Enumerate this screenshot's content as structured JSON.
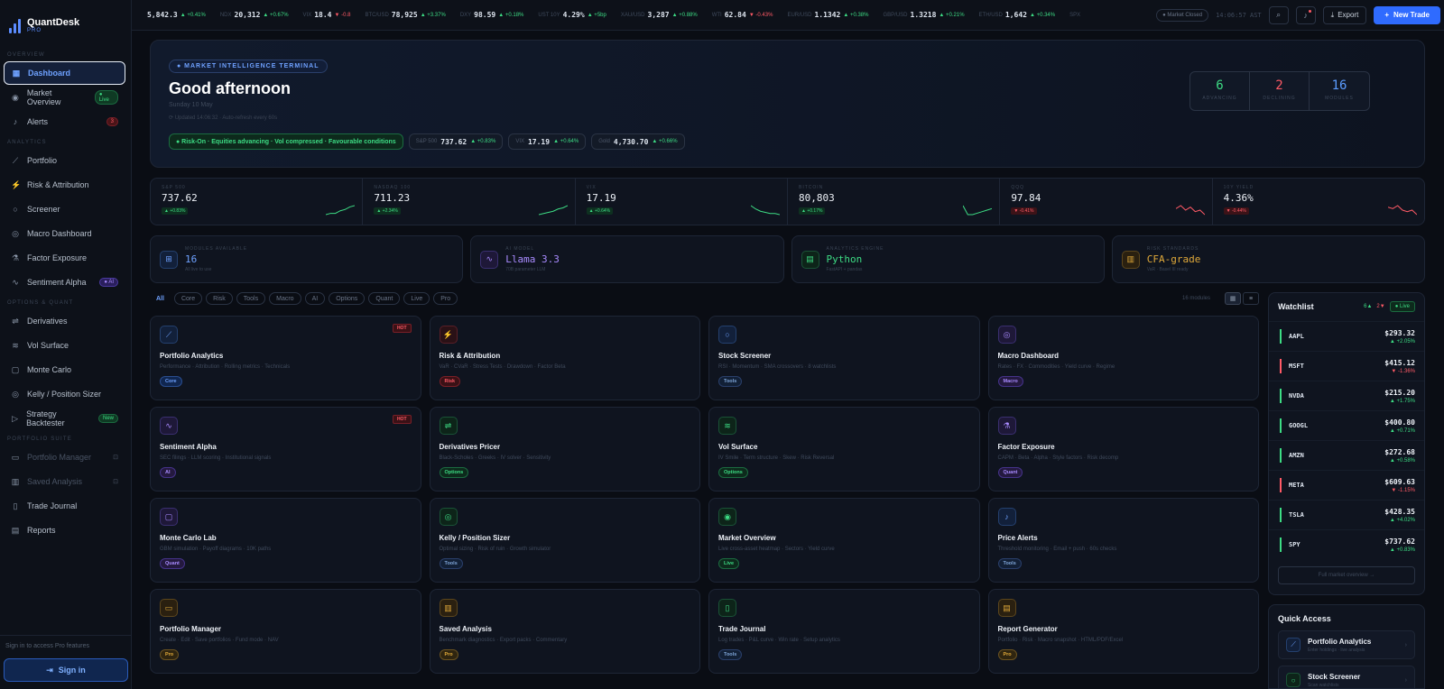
{
  "app": {
    "name": "QuantDesk",
    "sub": "PRO"
  },
  "sidebar": {
    "sections": [
      {
        "label": "OVERVIEW",
        "items": [
          {
            "label": "Dashboard",
            "icon": "grid-icon",
            "glyph": "▦",
            "active": true
          },
          {
            "label": "Market Overview",
            "icon": "broadcast-icon",
            "glyph": "◉",
            "badge": "● Live",
            "badge_kind": "live"
          },
          {
            "label": "Alerts",
            "icon": "bell-icon",
            "glyph": "♪",
            "badge": "3",
            "badge_kind": "red"
          }
        ]
      },
      {
        "label": "ANALYTICS",
        "items": [
          {
            "label": "Portfolio",
            "icon": "trend-icon",
            "glyph": "⟋"
          },
          {
            "label": "Risk & Attribution",
            "icon": "bolt-icon",
            "glyph": "⚡"
          },
          {
            "label": "Screener",
            "icon": "search-icon",
            "glyph": "○"
          },
          {
            "label": "Macro Dashboard",
            "icon": "globe-icon",
            "glyph": "◎"
          },
          {
            "label": "Factor Exposure",
            "icon": "flask-icon",
            "glyph": "⚗"
          },
          {
            "label": "Sentiment Alpha",
            "icon": "pulse-icon",
            "glyph": "∿",
            "badge": "● AI",
            "badge_kind": "ai"
          }
        ]
      },
      {
        "label": "OPTIONS & QUANT",
        "items": [
          {
            "label": "Derivatives",
            "icon": "sliders-icon",
            "glyph": "⇌"
          },
          {
            "label": "Vol Surface",
            "icon": "layers-icon",
            "glyph": "≋"
          },
          {
            "label": "Monte Carlo",
            "icon": "dice-icon",
            "glyph": "▢"
          },
          {
            "label": "Kelly / Position Sizer",
            "icon": "target-icon",
            "glyph": "◎"
          },
          {
            "label": "Strategy Backtester",
            "icon": "play-icon",
            "glyph": "▷",
            "badge": "New",
            "badge_kind": "new"
          }
        ]
      },
      {
        "label": "PORTFOLIO SUITE",
        "items": [
          {
            "label": "Portfolio Manager",
            "icon": "folder-icon",
            "glyph": "▭",
            "locked": true
          },
          {
            "label": "Saved Analysis",
            "icon": "chart-icon",
            "glyph": "▥",
            "locked": true
          },
          {
            "label": "Trade Journal",
            "icon": "book-icon",
            "glyph": "▯"
          },
          {
            "label": "Reports",
            "icon": "document-icon",
            "glyph": "▤"
          }
        ]
      }
    ],
    "footer_note": "Sign in to access Pro features",
    "signin_label": "Sign in"
  },
  "ticker": [
    {
      "sym": "",
      "val": "5,842.3",
      "chg": "▲ +0.41%",
      "dir": "up"
    },
    {
      "sym": "NDX",
      "val": "20,312",
      "chg": "▲ +0.67%",
      "dir": "up"
    },
    {
      "sym": "VIX",
      "val": "18.4",
      "chg": "▼ -0.8",
      "dir": "dn"
    },
    {
      "sym": "BTC/USD",
      "val": "78,925",
      "chg": "▲ +3.37%",
      "dir": "up"
    },
    {
      "sym": "DXY",
      "val": "98.59",
      "chg": "▲ +0.18%",
      "dir": "up"
    },
    {
      "sym": "UST 10Y",
      "val": "4.29%",
      "chg": "▲ +5bp",
      "dir": "up"
    },
    {
      "sym": "XAU/USD",
      "val": "3,287",
      "chg": "▲ +0.88%",
      "dir": "up"
    },
    {
      "sym": "WTI",
      "val": "62.84",
      "chg": "▼ -0.43%",
      "dir": "dn"
    },
    {
      "sym": "EUR/USD",
      "val": "1.1342",
      "chg": "▲ +0.38%",
      "dir": "up"
    },
    {
      "sym": "GBP/USD",
      "val": "1.3218",
      "chg": "▲ +0.21%",
      "dir": "up"
    },
    {
      "sym": "ETH/USD",
      "val": "1,642",
      "chg": "▲ +0.34%",
      "dir": "up"
    },
    {
      "sym": "SPX",
      "val": "",
      "chg": "",
      "dir": "up"
    }
  ],
  "topbar": {
    "market_status": "● Market Closed",
    "clock": "14:06:57 AST",
    "export_label": "Export",
    "new_trade_label": "New Trade"
  },
  "hero": {
    "pill": "● MARKET INTELLIGENCE TERMINAL",
    "greeting": "Good afternoon",
    "date": "Sunday 10 May",
    "updated": "⟳ Updated 14:06:32 · Auto-refresh every 60s",
    "risk_chip": "● Risk-On · Equities advancing · Vol compressed · Favourable conditions",
    "chips": [
      {
        "label": "S&P 500",
        "val": "737.62",
        "chg": "▲ +0.83%"
      },
      {
        "label": "VIX",
        "val": "17.19",
        "chg": "▲ +0.64%"
      },
      {
        "label": "Gold",
        "val": "4,730.70",
        "chg": "▲ +0.66%"
      }
    ],
    "counts": [
      {
        "n": "6",
        "label": "ADVANCING",
        "color": "#3ddc84"
      },
      {
        "n": "2",
        "label": "DECLINING",
        "color": "#ff5a66"
      },
      {
        "n": "16",
        "label": "MODULES",
        "color": "#5b9cff"
      }
    ]
  },
  "indices": [
    {
      "label": "S&P 500",
      "val": "737.62",
      "chg": "▲ +0.83%",
      "dir": "up",
      "spark": [
        2,
        3,
        3,
        5,
        6,
        8,
        9
      ]
    },
    {
      "label": "NASDAQ 100",
      "val": "711.23",
      "chg": "▲ +2.34%",
      "dir": "up",
      "spark": [
        1,
        2,
        3,
        4,
        6,
        7,
        9
      ]
    },
    {
      "label": "VIX",
      "val": "17.19",
      "chg": "▲ +0.64%",
      "dir": "up",
      "spark": [
        9,
        6,
        4,
        3,
        2,
        2,
        1
      ]
    },
    {
      "label": "BITCOIN",
      "val": "80,803",
      "chg": "▲ +0.17%",
      "dir": "up",
      "spark": [
        8,
        2,
        2,
        3,
        4,
        5,
        6
      ]
    },
    {
      "label": "QQQ",
      "val": "97.84",
      "chg": "▼ -0.41%",
      "dir": "dn",
      "spark": [
        6,
        8,
        5,
        7,
        4,
        5,
        2
      ]
    },
    {
      "label": "10Y YIELD",
      "val": "4.36%",
      "chg": "▼ -0.44%",
      "dir": "dn",
      "spark": [
        7,
        6,
        8,
        5,
        4,
        5,
        2
      ]
    }
  ],
  "stats": [
    {
      "label": "MODULES AVAILABLE",
      "val": "16",
      "sub": "All live to use",
      "icon": "cpu-icon",
      "glyph": "⊞",
      "kind": "blue",
      "color": "#6ea1ff"
    },
    {
      "label": "AI MODEL",
      "val": "Llama 3.3",
      "sub": "70B parameter LLM",
      "icon": "pulse-icon",
      "glyph": "∿",
      "kind": "purple",
      "color": "#a98bff"
    },
    {
      "label": "ANALYTICS ENGINE",
      "val": "Python",
      "sub": "FastAPI + pandas",
      "icon": "database-icon",
      "glyph": "▤",
      "kind": "green",
      "color": "#3ddc84"
    },
    {
      "label": "RISK STANDARDS",
      "val": "CFA-grade",
      "sub": "VaR · Basel III ready",
      "icon": "bar-chart-icon",
      "glyph": "▥",
      "kind": "amber",
      "color": "#e0a93a"
    }
  ],
  "filters": [
    "All",
    "Core",
    "Risk",
    "Tools",
    "Macro",
    "AI",
    "Options",
    "Quant",
    "Live",
    "Pro"
  ],
  "module_count": "16 modules",
  "modules": [
    {
      "title": "Portfolio Analytics",
      "desc": "Performance · Attribution · Rolling metrics · Technicals",
      "tag": "Core",
      "tagc": "core",
      "icon": "trend-icon",
      "glyph": "⟋",
      "kind": "blue",
      "hot": true
    },
    {
      "title": "Risk & Attribution",
      "desc": "VaR · CVaR · Stress Tests · Drawdown · Factor Beta",
      "tag": "Risk",
      "tagc": "risk",
      "icon": "bolt-icon",
      "glyph": "⚡",
      "kind": "red"
    },
    {
      "title": "Stock Screener",
      "desc": "RSI · Momentum · SMA crossovers · 8 watchlists",
      "tag": "Tools",
      "tagc": "tools",
      "icon": "search-icon",
      "glyph": "○",
      "kind": "blue"
    },
    {
      "title": "Macro Dashboard",
      "desc": "Rates · FX · Commodities · Yield curve · Regime",
      "tag": "Macro",
      "tagc": "macro",
      "icon": "globe-icon",
      "glyph": "◎",
      "kind": "purple"
    },
    {
      "title": "Sentiment Alpha",
      "desc": "SEC filings · LLM scoring · Institutional signals",
      "tag": "AI",
      "tagc": "ai",
      "icon": "pulse-icon",
      "glyph": "∿",
      "kind": "purple",
      "hot": true
    },
    {
      "title": "Derivatives Pricer",
      "desc": "Black-Scholes · Greeks · IV solver · Sensitivity",
      "tag": "Options",
      "tagc": "options",
      "icon": "sliders-icon",
      "glyph": "⇌",
      "kind": "green"
    },
    {
      "title": "Vol Surface",
      "desc": "IV Smile · Term structure · Skew · Risk Reversal",
      "tag": "Options",
      "tagc": "options",
      "icon": "layers-icon",
      "glyph": "≋",
      "kind": "green"
    },
    {
      "title": "Factor Exposure",
      "desc": "CAPM · Beta · Alpha · Style factors · Risk decomp",
      "tag": "Quant",
      "tagc": "quant",
      "icon": "flask-icon",
      "glyph": "⚗",
      "kind": "purple"
    },
    {
      "title": "Monte Carlo Lab",
      "desc": "GBM simulation · Payoff diagrams · 10K paths",
      "tag": "Quant",
      "tagc": "quant",
      "icon": "dice-icon",
      "glyph": "▢",
      "kind": "purple"
    },
    {
      "title": "Kelly / Position Sizer",
      "desc": "Optimal sizing · Risk of ruin · Growth simulator",
      "tag": "Tools",
      "tagc": "tools",
      "icon": "target-icon",
      "glyph": "◎",
      "kind": "green"
    },
    {
      "title": "Market Overview",
      "desc": "Live cross-asset heatmap · Sectors · Yield curve",
      "tag": "Live",
      "tagc": "live",
      "icon": "broadcast-icon",
      "glyph": "◉",
      "kind": "green"
    },
    {
      "title": "Price Alerts",
      "desc": "Threshold monitoring · Email + push · 60s checks",
      "tag": "Tools",
      "tagc": "tools",
      "icon": "bell-icon",
      "glyph": "♪",
      "kind": "blue"
    },
    {
      "title": "Portfolio Manager",
      "desc": "Create · Edit · Save portfolios · Fund mode · NAV",
      "tag": "Pro",
      "tagc": "pro",
      "icon": "folder-icon",
      "glyph": "▭",
      "kind": "amber"
    },
    {
      "title": "Saved Analysis",
      "desc": "Benchmark diagnostics · Export packs · Commentary",
      "tag": "Pro",
      "tagc": "pro",
      "icon": "bar-chart-icon",
      "glyph": "▥",
      "kind": "amber"
    },
    {
      "title": "Trade Journal",
      "desc": "Log trades · P&L curve · Win rate · Setup analytics",
      "tag": "Tools",
      "tagc": "tools",
      "icon": "book-icon",
      "glyph": "▯",
      "kind": "green"
    },
    {
      "title": "Report Generator",
      "desc": "Portfolio · Risk · Macro snapshot · HTML/PDF/Excel",
      "tag": "Pro",
      "tagc": "pro",
      "icon": "document-icon",
      "glyph": "▤",
      "kind": "amber"
    }
  ],
  "hot_label": "HOT",
  "watchlist": {
    "title": "Watchlist",
    "up_count": "6▲",
    "down_count": "2▼",
    "live_label": "● Live",
    "rows": [
      {
        "sym": "AAPL",
        "price": "$293.32",
        "chg": "▲ +2.05%",
        "dir": "up"
      },
      {
        "sym": "MSFT",
        "price": "$415.12",
        "chg": "▼ -1.36%",
        "dir": "dn"
      },
      {
        "sym": "NVDA",
        "price": "$215.20",
        "chg": "▲ +1.75%",
        "dir": "up"
      },
      {
        "sym": "GOOGL",
        "price": "$400.80",
        "chg": "▲ +0.71%",
        "dir": "up"
      },
      {
        "sym": "AMZN",
        "price": "$272.68",
        "chg": "▲ +0.58%",
        "dir": "up"
      },
      {
        "sym": "META",
        "price": "$609.63",
        "chg": "▼ -1.15%",
        "dir": "dn"
      },
      {
        "sym": "TSLA",
        "price": "$428.35",
        "chg": "▲ +4.02%",
        "dir": "up"
      },
      {
        "sym": "SPY",
        "price": "$737.62",
        "chg": "▲ +0.83%",
        "dir": "up"
      }
    ],
    "full_label": "Full market overview →"
  },
  "quick_access": {
    "title": "Quick Access",
    "items": [
      {
        "name": "Portfolio Analytics",
        "sub": "Enter holdings · live analysis",
        "icon": "trend-icon",
        "glyph": "⟋",
        "kind": "blue"
      },
      {
        "name": "Stock Screener",
        "sub": "Scan watchlists",
        "icon": "search-icon",
        "glyph": "○",
        "kind": "green"
      }
    ]
  },
  "colors": {
    "accent": "#2f6bff",
    "up": "#3ddc84",
    "down": "#ff5a66",
    "bg": "#0a0d14"
  }
}
